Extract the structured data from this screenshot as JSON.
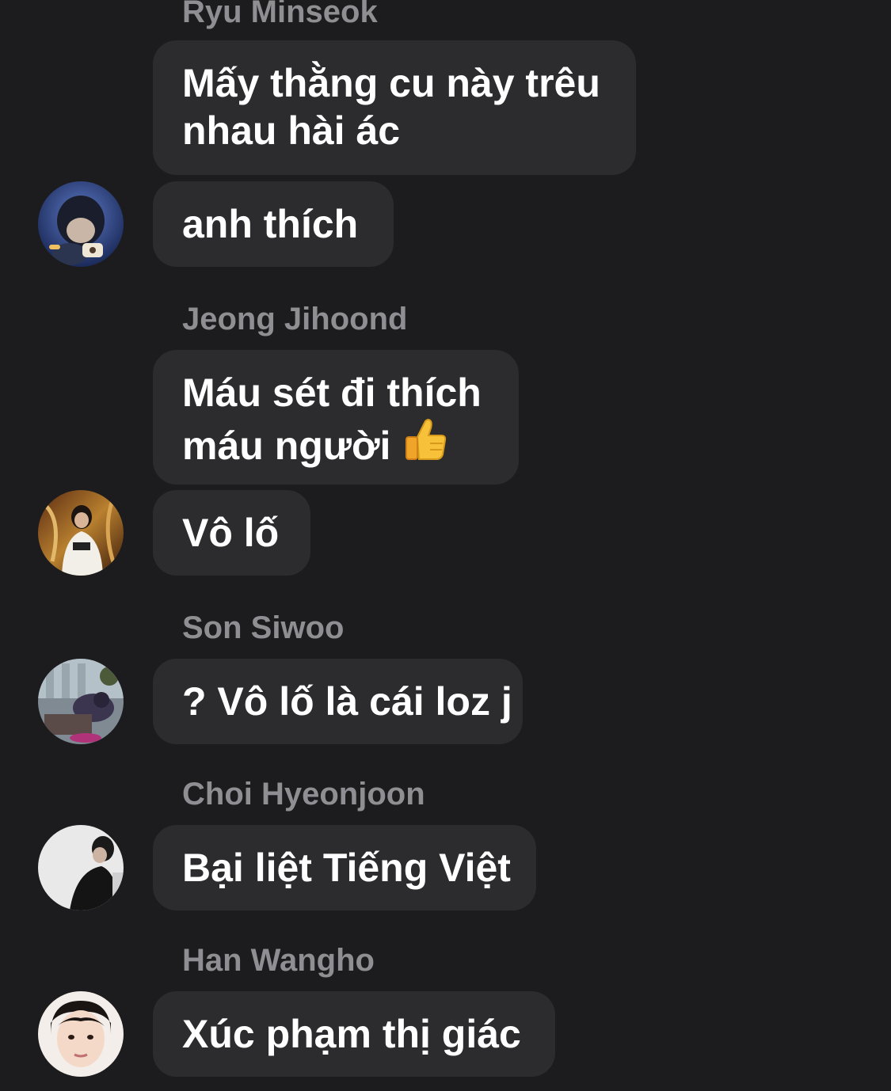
{
  "conversation": {
    "groups": [
      {
        "sender": "Ryu Minseok",
        "messages": [
          "Mấy thằng cu này trêu\nnhau hài ác",
          "anh thích"
        ],
        "avatar_icon": "avatar-ryu-minseok"
      },
      {
        "sender": "Jeong Jihoond",
        "messages": [
          "Máu sét đi thích\nmáu người",
          "Vô lố"
        ],
        "reaction_emoji": "thumbs-up-icon",
        "avatar_icon": "avatar-jeong-jihoond"
      },
      {
        "sender": "Son Siwoo",
        "messages": [
          "? Vô lố là cái loz j"
        ],
        "avatar_icon": "avatar-son-siwoo"
      },
      {
        "sender": "Choi Hyeonjoon",
        "messages": [
          "Bại liệt Tiếng Việt"
        ],
        "avatar_icon": "avatar-choi-hyeonjoon"
      },
      {
        "sender": "Han Wangho",
        "messages": [
          "Xúc phạm thị giác"
        ],
        "avatar_icon": "avatar-han-wangho"
      }
    ]
  },
  "colors": {
    "background": "#1c1c1e",
    "bubble": "#2c2c2e",
    "sender_name": "#8e8e93",
    "message_text": "#ffffff"
  }
}
